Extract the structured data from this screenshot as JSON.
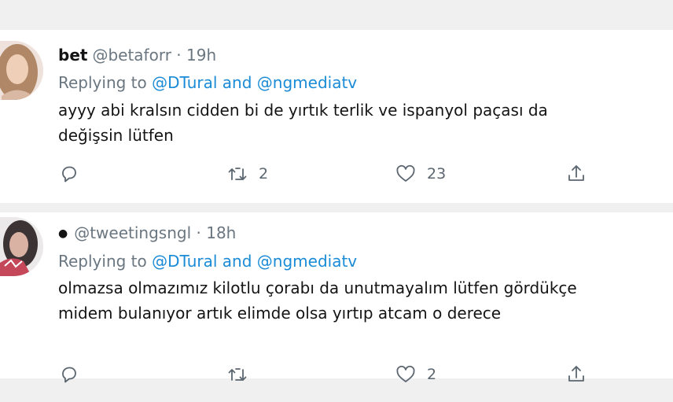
{
  "tweets": [
    {
      "display_name": "bet",
      "handle": "@betaforr",
      "time": "· 19h",
      "replying_prefix": "Replying to",
      "mention1": "@DTural",
      "and": "and",
      "mention2": "@ngmediatv",
      "text_line1": "ayyy abi kralsın cidden bi de yırtık terlik ve ispanyol paçası da",
      "text_line2": "değişsin lütfen",
      "retweet_count": "2",
      "like_count": "23"
    },
    {
      "handle": "@tweetingsngl",
      "time": "· 18h",
      "replying_prefix": "Replying to",
      "mention1": "@DTural",
      "and": "and",
      "mention2": "@ngmediatv",
      "text_line1": "olmazsa olmazımız kilotlu çorabı da unutmayalım lütfen gördükçe",
      "text_line2": "midem bulanıyor artık elimde olsa yırtıp atcam o derece",
      "like_count": "2"
    }
  ],
  "icons": {
    "reply": "reply-icon",
    "retweet": "retweet-icon",
    "like": "heart-icon",
    "share": "share-icon",
    "dot": "bullet-dot"
  }
}
